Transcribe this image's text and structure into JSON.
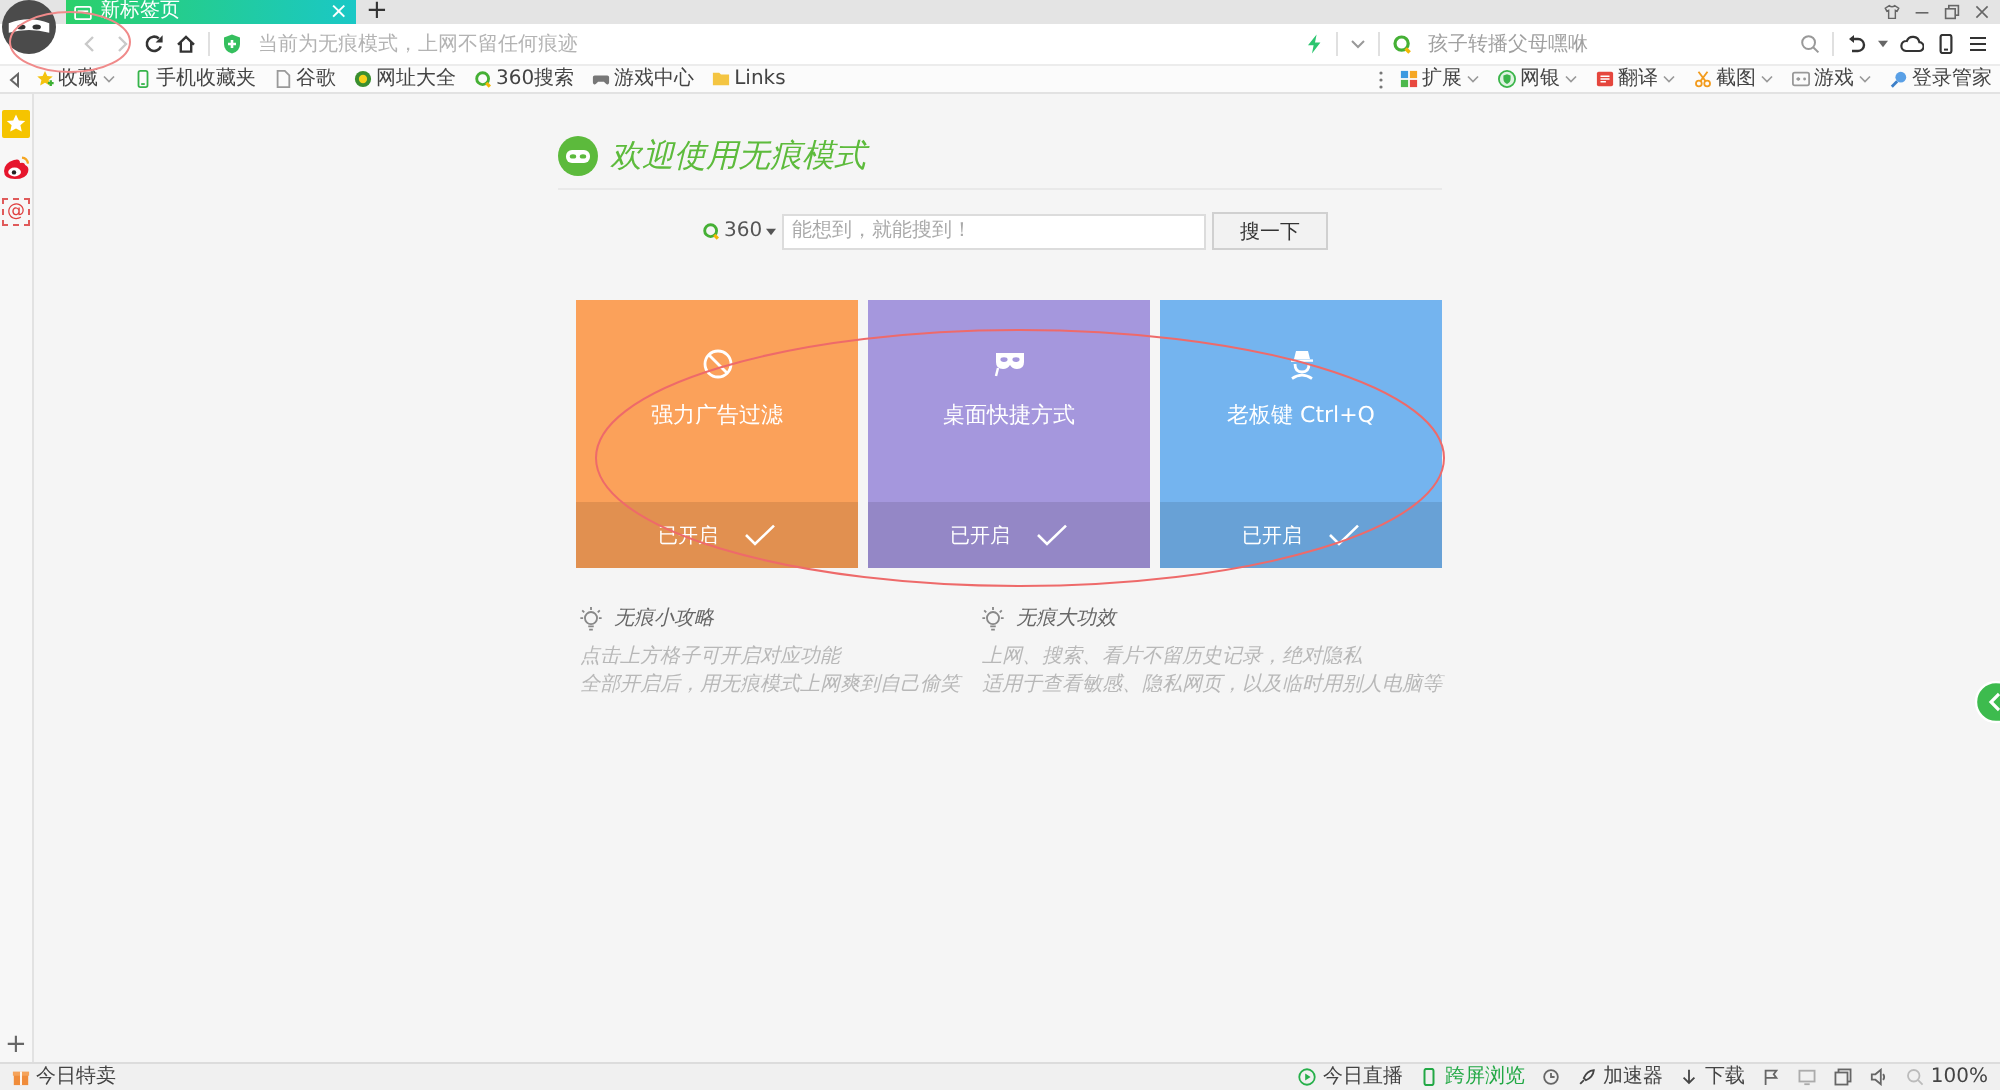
{
  "tab_bar": {
    "tabs": [
      {
        "title": "新标签页",
        "selected": true,
        "close": "×"
      }
    ],
    "new_tab": "+"
  },
  "toolbar": {
    "circled": true,
    "nav": [
      {
        "kind": "back",
        "disabled": true
      },
      {
        "kind": "forward",
        "disabled": true
      },
      {
        "kind": "refresh",
        "disabled": false
      },
      {
        "kind": "home",
        "disabled": false
      }
    ],
    "address_bar": {
      "placeholder": "当前为无痕模式，上网不留任何痕迹"
    },
    "search_box": {
      "placeholder": "孩子转播父母嘿咻"
    }
  },
  "bookmarks_bar": {
    "items": [
      {
        "kind": "favorites",
        "label": "收藏",
        "menu": true
      },
      {
        "kind": "mobile",
        "label": "手机收藏夹",
        "menu": false
      },
      {
        "kind": "page",
        "label": "谷歌",
        "menu": false
      },
      {
        "kind": "sites",
        "label": "网址大全",
        "menu": false
      },
      {
        "kind": "search",
        "label": "360搜索",
        "menu": false
      },
      {
        "kind": "game",
        "label": "游戏中心",
        "menu": false
      },
      {
        "kind": "folder",
        "label": "Links",
        "menu": false
      }
    ],
    "tools": [
      {
        "kind": "extensions",
        "label": "扩展",
        "menu": true
      },
      {
        "kind": "bank",
        "label": "网银",
        "menu": true
      },
      {
        "kind": "translate",
        "label": "翻译",
        "menu": true
      },
      {
        "kind": "screenshot",
        "label": "截图",
        "menu": true
      },
      {
        "kind": "games",
        "label": "游戏",
        "menu": true
      },
      {
        "kind": "login",
        "label": "登录管家",
        "menu": false
      }
    ]
  },
  "sidebar": {
    "items": [
      {
        "kind": "favorites"
      },
      {
        "kind": "social"
      },
      {
        "kind": "mail",
        "glyph": "@"
      }
    ],
    "add": "+"
  },
  "incognito_page": {
    "title": "欢迎使用无痕模式",
    "search": {
      "engine": "360",
      "placeholder": "能想到，就能搜到！",
      "button": "搜一下"
    },
    "features": {
      "circled": true,
      "cards": [
        {
          "kind": "adblock",
          "title": "强力广告过滤",
          "status": "已开启",
          "on": true,
          "color": "#fba15a"
        },
        {
          "kind": "shortcut",
          "title": "桌面快捷方式",
          "status": "已开启",
          "on": true,
          "color": "#a597dd"
        },
        {
          "kind": "bosskey",
          "title": "老板键 Ctrl+Q",
          "status": "已开启",
          "on": true,
          "color": "#74b4ef"
        }
      ]
    },
    "tips": [
      {
        "title": "无痕小攻略",
        "lines": [
          "点击上方格子可开启对应功能",
          "全部开启后，用无痕模式上网爽到自己偷笑"
        ]
      },
      {
        "title": "无痕大功效",
        "lines": [
          "上网、搜索、看片不留历史记录，绝对隐私",
          "适用于查看敏感、隐私网页，以及临时用别人电脑等"
        ]
      }
    ]
  },
  "status_bar": {
    "left": [
      {
        "kind": "deals",
        "label": "今日特卖",
        "active": false
      }
    ],
    "right": [
      {
        "kind": "live",
        "label": "今日直播",
        "active": false
      },
      {
        "kind": "cross_screen",
        "label": "跨屏浏览",
        "active": true
      },
      {
        "kind": "history",
        "active": false
      },
      {
        "kind": "accelerator",
        "label": "加速器",
        "active": false
      },
      {
        "kind": "download",
        "label": "下载",
        "active": false
      },
      {
        "kind": "flag",
        "active": false
      },
      {
        "kind": "monitor",
        "active": false
      },
      {
        "kind": "window",
        "active": false
      },
      {
        "kind": "sound",
        "active": false
      },
      {
        "kind": "zoom",
        "label": "100%",
        "active": false
      }
    ]
  }
}
